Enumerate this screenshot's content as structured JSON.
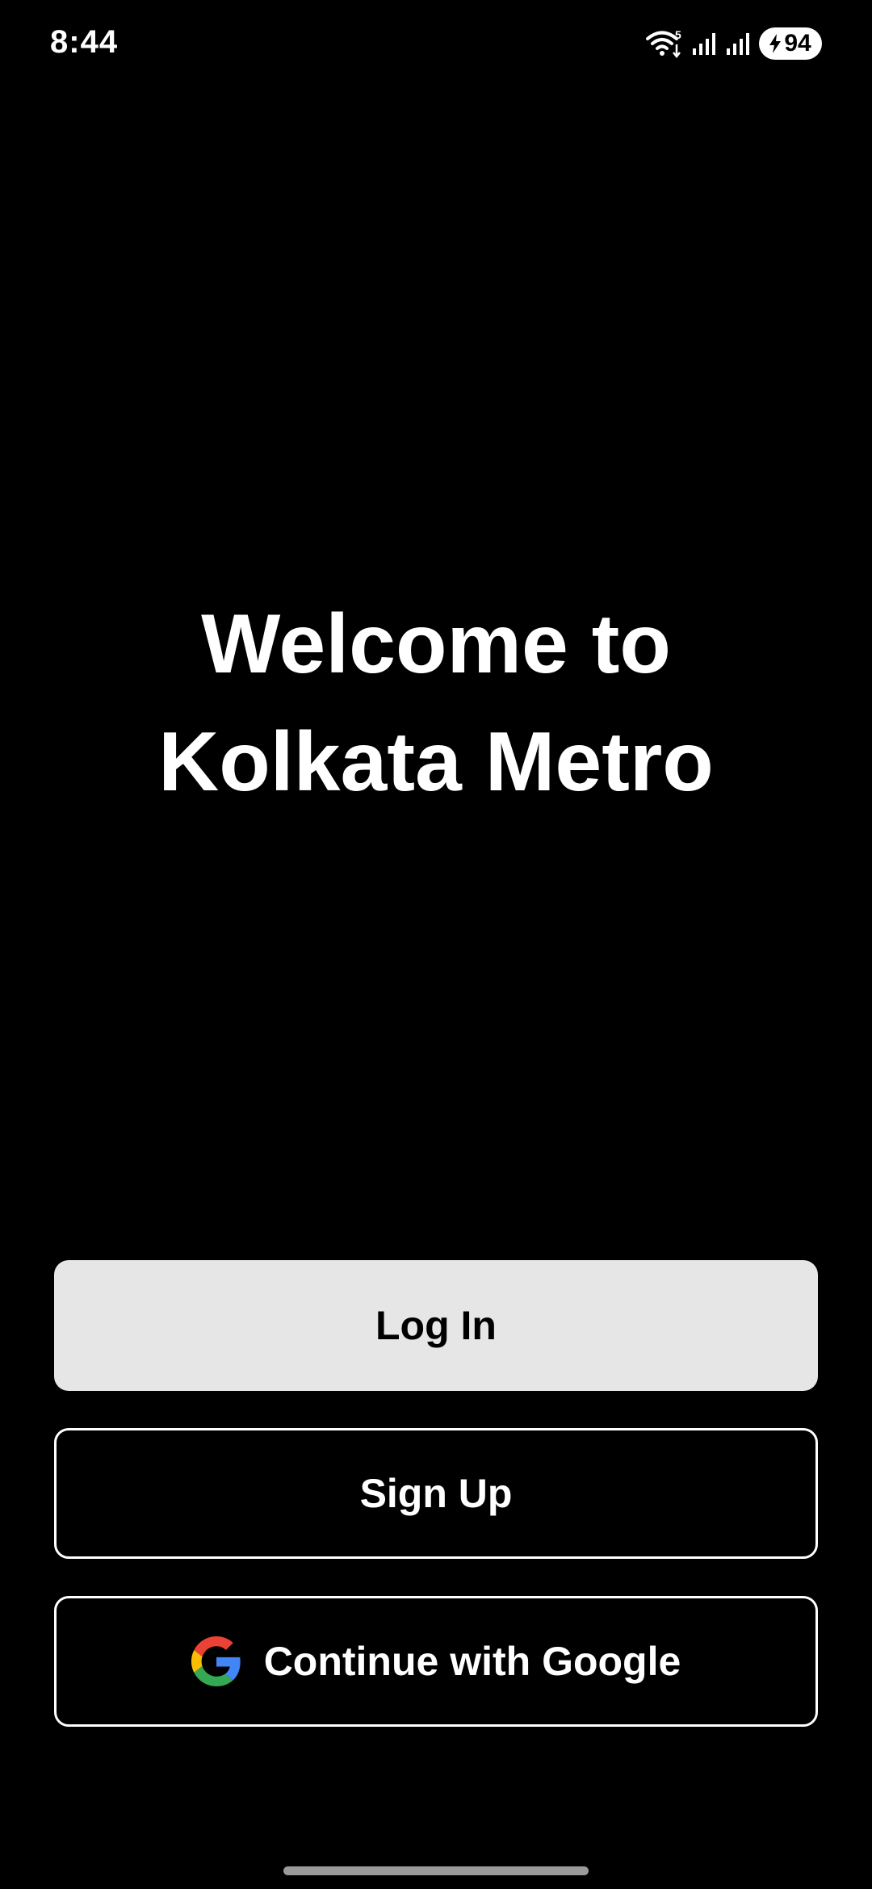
{
  "status_bar": {
    "time": "8:44",
    "wifi_label": "5",
    "battery_level": "94",
    "icons": [
      "wifi-icon",
      "signal-icon",
      "signal-icon",
      "charging-bolt-icon"
    ]
  },
  "welcome": {
    "line1": "Welcome to",
    "line2": "Kolkata Metro"
  },
  "buttons": {
    "login_label": "Log In",
    "signup_label": "Sign Up",
    "google_label": "Continue with Google"
  },
  "colors": {
    "background": "#000000",
    "text": "#ffffff",
    "login_button_bg": "#e6e6e6",
    "login_button_text": "#000000",
    "google_blue": "#4285F4",
    "google_red": "#EA4335",
    "google_yellow": "#FBBC05",
    "google_green": "#34A853"
  }
}
